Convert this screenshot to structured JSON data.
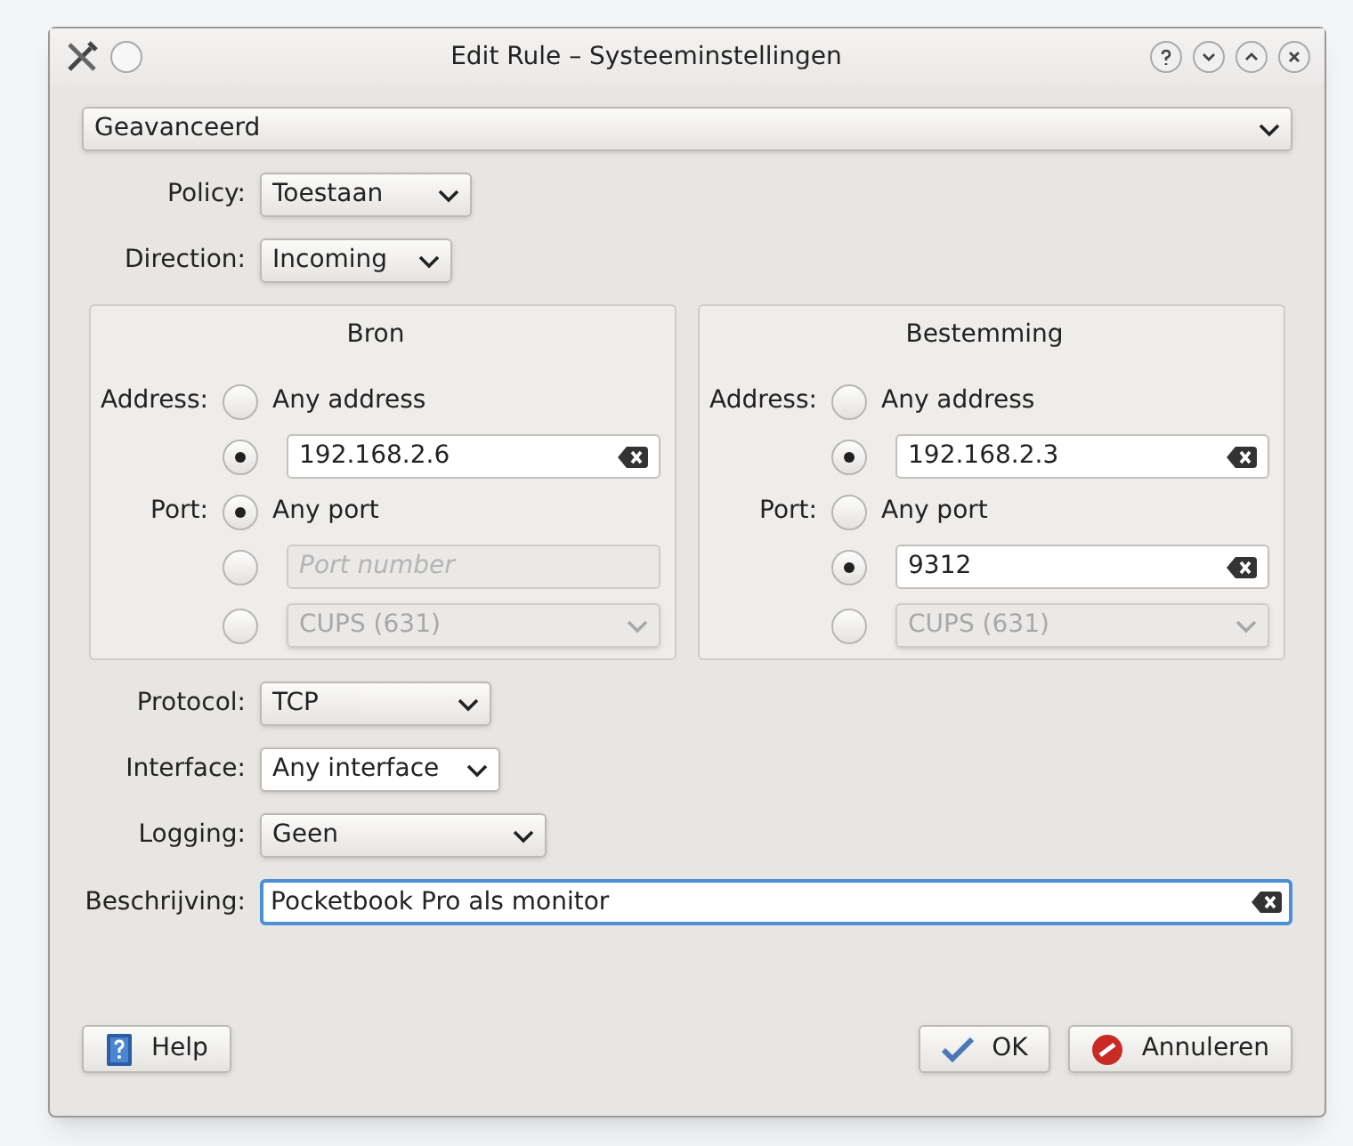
{
  "window": {
    "title": "Edit Rule – Systeeminstellingen"
  },
  "mode": {
    "value": "Geavanceerd"
  },
  "top_fields": [
    {
      "label": "Policy:",
      "value": "Toestaan"
    },
    {
      "label": "Direction:",
      "value": "Incoming"
    }
  ],
  "panels": [
    {
      "title": "Bron",
      "address_label": "Address:",
      "port_label": "Port:",
      "address_options": [
        {
          "kind": "radio",
          "label": "Any address",
          "selected": false
        },
        {
          "kind": "field",
          "value": "192.168.2.6",
          "selected": true,
          "disabled": false
        }
      ],
      "port_options": [
        {
          "kind": "radio",
          "label": "Any port",
          "selected": true
        },
        {
          "kind": "field",
          "placeholder": "Port number",
          "selected": false,
          "disabled": true
        },
        {
          "kind": "select",
          "value": "CUPS (631)",
          "selected": false,
          "disabled": true
        }
      ]
    },
    {
      "title": "Bestemming",
      "address_label": "Address:",
      "port_label": "Port:",
      "address_options": [
        {
          "kind": "radio",
          "label": "Any address",
          "selected": false
        },
        {
          "kind": "field",
          "value": "192.168.2.3",
          "selected": true,
          "disabled": false
        }
      ],
      "port_options": [
        {
          "kind": "radio",
          "label": "Any port",
          "selected": false
        },
        {
          "kind": "field",
          "value": "9312",
          "selected": true,
          "disabled": false
        },
        {
          "kind": "select",
          "value": "CUPS (631)",
          "selected": false,
          "disabled": true
        }
      ]
    }
  ],
  "bottom_fields": [
    {
      "label": "Protocol:",
      "value": "TCP",
      "kind": "button"
    },
    {
      "label": "Interface:",
      "value": "Any interface",
      "kind": "editable"
    },
    {
      "label": "Logging:",
      "value": "Geen",
      "kind": "button"
    }
  ],
  "description": {
    "label": "Beschrijving:",
    "value": "Pocketbook Pro als monitor",
    "focused": true
  },
  "buttons": [
    {
      "label": "Help",
      "kind": "help"
    },
    {
      "label": "OK",
      "kind": "ok"
    },
    {
      "label": "Annuleren",
      "kind": "cancel"
    }
  ]
}
